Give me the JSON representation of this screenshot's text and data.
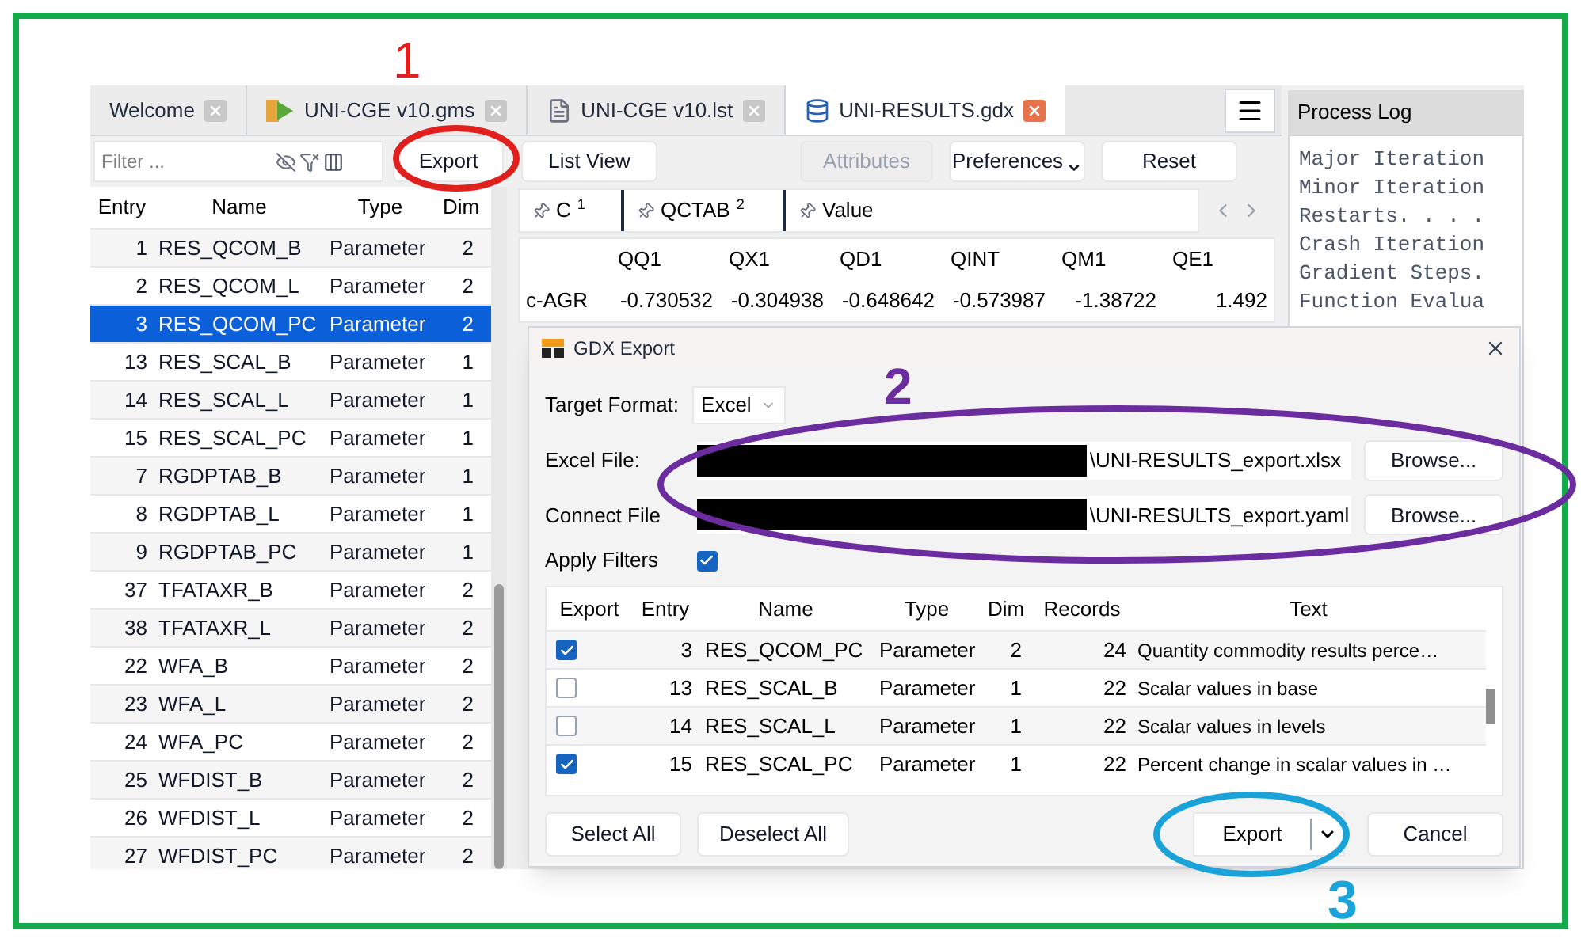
{
  "annotations": [
    {
      "label": "1",
      "color": "#e0201c"
    },
    {
      "label": "2",
      "color": "#6a2c9e"
    },
    {
      "label": "3",
      "color": "#1aa3d9"
    }
  ],
  "tabs": [
    {
      "label": "Welcome",
      "kind": "plain",
      "selected": false
    },
    {
      "label": "UNI-CGE v10.gms",
      "kind": "gms",
      "selected": false
    },
    {
      "label": "UNI-CGE v10.lst",
      "kind": "file",
      "selected": false
    },
    {
      "label": "UNI-RESULTS.gdx",
      "kind": "database",
      "selected": true
    }
  ],
  "symbol_panel": {
    "filter_placeholder": "Filter ...",
    "export_button": "Export",
    "columns": [
      "Entry",
      "Name",
      "Type",
      "Dim"
    ],
    "rows": [
      {
        "entry": "1",
        "name": "RES_QCOM_B",
        "type": "Parameter",
        "dim": "2",
        "selected": false
      },
      {
        "entry": "2",
        "name": "RES_QCOM_L",
        "type": "Parameter",
        "dim": "2",
        "selected": false
      },
      {
        "entry": "3",
        "name": "RES_QCOM_PC",
        "type": "Parameter",
        "dim": "2",
        "selected": true
      },
      {
        "entry": "13",
        "name": "RES_SCAL_B",
        "type": "Parameter",
        "dim": "1",
        "selected": false
      },
      {
        "entry": "14",
        "name": "RES_SCAL_L",
        "type": "Parameter",
        "dim": "1",
        "selected": false
      },
      {
        "entry": "15",
        "name": "RES_SCAL_PC",
        "type": "Parameter",
        "dim": "1",
        "selected": false
      },
      {
        "entry": "7",
        "name": "RGDPTAB_B",
        "type": "Parameter",
        "dim": "1",
        "selected": false
      },
      {
        "entry": "8",
        "name": "RGDPTAB_L",
        "type": "Parameter",
        "dim": "1",
        "selected": false
      },
      {
        "entry": "9",
        "name": "RGDPTAB_PC",
        "type": "Parameter",
        "dim": "1",
        "selected": false
      },
      {
        "entry": "37",
        "name": "TFATAXR_B",
        "type": "Parameter",
        "dim": "2",
        "selected": false
      },
      {
        "entry": "38",
        "name": "TFATAXR_L",
        "type": "Parameter",
        "dim": "2",
        "selected": false
      },
      {
        "entry": "22",
        "name": "WFA_B",
        "type": "Parameter",
        "dim": "2",
        "selected": false
      },
      {
        "entry": "23",
        "name": "WFA_L",
        "type": "Parameter",
        "dim": "2",
        "selected": false
      },
      {
        "entry": "24",
        "name": "WFA_PC",
        "type": "Parameter",
        "dim": "2",
        "selected": false
      },
      {
        "entry": "25",
        "name": "WFDIST_B",
        "type": "Parameter",
        "dim": "2",
        "selected": false
      },
      {
        "entry": "26",
        "name": "WFDIST_L",
        "type": "Parameter",
        "dim": "2",
        "selected": false
      },
      {
        "entry": "27",
        "name": "WFDIST_PC",
        "type": "Parameter",
        "dim": "2",
        "selected": false
      }
    ]
  },
  "data_view": {
    "toolbar": [
      {
        "label": "List View",
        "kind": "button",
        "disabled": false
      },
      {
        "label": "Attributes",
        "kind": "button",
        "disabled": true
      },
      {
        "label": "Preferences",
        "kind": "dropdown",
        "disabled": false
      },
      {
        "label": "Reset",
        "kind": "button",
        "disabled": false
      }
    ],
    "domains": [
      {
        "label": "C",
        "index": "1"
      },
      {
        "label": "QCTAB",
        "index": "2"
      },
      {
        "label": "Value"
      }
    ],
    "columns": [
      "QQ1",
      "QX1",
      "QD1",
      "QINT",
      "QM1",
      "QE1"
    ],
    "rows": [
      {
        "label": "c-AGR",
        "values": [
          "-0.730532",
          "-0.304938",
          "-0.648642",
          "-0.573987",
          "-1.38722",
          "1.492"
        ]
      }
    ]
  },
  "process_log": {
    "title": "Process Log",
    "lines": [
      "Major Iteration",
      "Minor Iteration",
      "Restarts. . . .",
      "Crash Iteration",
      "Gradient Steps.",
      "Function Evalua"
    ]
  },
  "dialog": {
    "title": "GDX Export",
    "target_format_label": "Target Format:",
    "target_format": "Excel",
    "files": [
      {
        "label": "Excel File:",
        "value": "\\UNI-RESULTS_export.xlsx",
        "browse_button": "Browse..."
      },
      {
        "label": "Connect File",
        "value": "\\UNI-RESULTS_export.yaml",
        "browse_button": "Browse..."
      }
    ],
    "apply_filters_label": "Apply Filters",
    "apply_filters": true,
    "columns": [
      "Export",
      "Entry",
      "Name",
      "Type",
      "Dim",
      "Records",
      "Text"
    ],
    "rows": [
      {
        "export": true,
        "entry": "3",
        "name": "RES_QCOM_PC",
        "type": "Parameter",
        "dim": "2",
        "records": "24",
        "text": "Quantity commodity results perce…"
      },
      {
        "export": false,
        "entry": "13",
        "name": "RES_SCAL_B",
        "type": "Parameter",
        "dim": "1",
        "records": "22",
        "text": "Scalar values in base"
      },
      {
        "export": false,
        "entry": "14",
        "name": "RES_SCAL_L",
        "type": "Parameter",
        "dim": "1",
        "records": "22",
        "text": "Scalar values in levels"
      },
      {
        "export": true,
        "entry": "15",
        "name": "RES_SCAL_PC",
        "type": "Parameter",
        "dim": "1",
        "records": "22",
        "text": "Percent change in scalar values in …"
      }
    ],
    "select_all": "Select All",
    "deselect_all": "Deselect All",
    "export_button": "Export",
    "cancel_button": "Cancel"
  }
}
